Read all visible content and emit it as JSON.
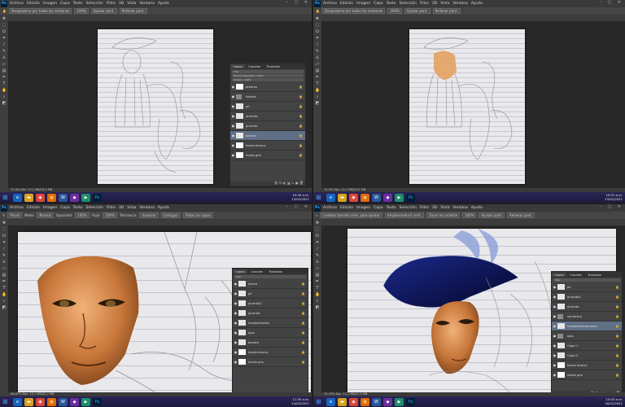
{
  "menu": [
    "Archivo",
    "Edición",
    "Imagen",
    "Capa",
    "Texto",
    "Selección",
    "Filtro",
    "3D",
    "Vista",
    "Ventana",
    "Ayuda"
  ],
  "app_icon": "Ps",
  "window_controls": "– ▢ ✕",
  "q1": {
    "options": [
      "Desplazarse por todas las ventanas",
      "100%",
      "Ajustar pant.",
      "Rellenar pant."
    ],
    "doc_tab": "SCI_Mtz_Digital_PaintIng_Mascara_14-02-2021_2088x3474-300.psd al 12.5% (bosceto, RGB/8) ×",
    "status": "12,5%   Doc: 12,1 MB/15,5 MB",
    "panel_tabs": [
      "Capas",
      "Canales",
      "Trazados"
    ],
    "layers_filter": "Tipo",
    "blend_mode": "Normal",
    "opacity": "Opacidad: 100%",
    "fill": "Relleno: 100%",
    "layers": [
      {
        "name": "piedras",
        "kind": "white",
        "sel": false
      },
      {
        "name": "fondos",
        "kind": "folder",
        "sel": false
      },
      {
        "name": "pil",
        "kind": "pattern",
        "sel": false
      },
      {
        "name": "plumita",
        "kind": "pattern",
        "sel": false
      },
      {
        "name": "plumita",
        "kind": "pattern",
        "sel": false
      },
      {
        "name": "boceto",
        "kind": "pattern",
        "sel": true
      },
      {
        "name": "fondo blanco",
        "kind": "white",
        "sel": false
      },
      {
        "name": "fondo gris",
        "kind": "white",
        "sel": false
      }
    ],
    "time": "10:40 a.m.",
    "date": "13/02/2021"
  },
  "q2": {
    "options": [
      "Desplazarse por todas las ventanas",
      "100%",
      "Ajustar pant.",
      "Rellenar pant."
    ],
    "doc_tab": "SCI_Mtz_Digital_PaintIng_Mascara_14-02-2021_2088x3474-300.psd al 12.5% (boscaro, RGB/8) ×",
    "status": "12,5%   Doc: 12,1 MB/15,5 MB",
    "time": "10:31 a.m.",
    "date": "13/02/2021"
  },
  "q3": {
    "options": [
      "Pincel",
      "Modo:",
      "Normal",
      "Opacidad:",
      "100%",
      "Flujo:",
      "100%",
      "Tolerancia:",
      "Suavizar",
      "Contiguo",
      "Todas las capas"
    ],
    "doc_tab": "SCI_Mtz_Digital_PaintIng_Mascara_14-02-2021_2088x3474-300.psd al 66.7% (sombrasdelrostro, RGB/8) ×",
    "status": "66,67%   Doc: 12,1 MB/20,7 MB",
    "panel_tabs": [
      "Capas",
      "Canales",
      "Trazados"
    ],
    "layers_filter": "Tipo",
    "layers": [
      {
        "name": "forma",
        "kind": "pattern",
        "sel": false
      },
      {
        "name": "pil",
        "kind": "pattern",
        "sel": false
      },
      {
        "name": "plumita2",
        "kind": "pattern",
        "sel": false
      },
      {
        "name": "plumita",
        "kind": "pattern",
        "sel": false
      },
      {
        "name": "fondbrillantes",
        "kind": "pattern",
        "sel": false
      },
      {
        "name": "ojos",
        "kind": "pattern",
        "sel": false
      },
      {
        "name": "boceto",
        "kind": "pattern",
        "sel": false
      },
      {
        "name": "fondo blanco",
        "kind": "white",
        "sel": false
      },
      {
        "name": "fondo gris",
        "kind": "white",
        "sel": false
      }
    ],
    "time": "11:35 a.m.",
    "date": "14/02/2021"
  },
  "q4": {
    "options": [
      "Cambiar tamaño vent. para ajustar",
      "Ampliar/reducir vent.",
      "Zoom en arrastre",
      "100%",
      "Ajustar pant.",
      "Rellenar pant."
    ],
    "doc_tab": "SCI_Mtz_Digital_PaintIng_Mascara_14-02-2021_2088x3474-300.psd al 33.3% (somrbasdelrostro01, RGB/8) ×",
    "status": "33,33%   Doc: 12,1 MB/23,9 MB",
    "panel_tabs": [
      "Capas",
      "Canales",
      "Trazados"
    ],
    "layers_filter": "Tipo",
    "layers": [
      {
        "name": "pil",
        "kind": "pattern",
        "sel": false
      },
      {
        "name": "plumita2",
        "kind": "pattern",
        "sel": false
      },
      {
        "name": "plumita",
        "kind": "pattern",
        "sel": false
      },
      {
        "name": "sombrero",
        "kind": "folder",
        "sel": false
      },
      {
        "name": "fondbrillantesrostro",
        "kind": "pattern",
        "sel": true
      },
      {
        "name": "ojos",
        "kind": "folder",
        "sel": false
      },
      {
        "name": "Capa 1",
        "kind": "pattern",
        "sel": false
      },
      {
        "name": "Capa 2",
        "kind": "pattern",
        "sel": false
      },
      {
        "name": "fondo blanco",
        "kind": "white",
        "sel": false
      },
      {
        "name": "fondo gris",
        "kind": "white",
        "sel": false
      }
    ],
    "time": "10:03 a.m.",
    "date": "16/02/2021"
  },
  "colors": {
    "ps_blue": "#31a8ff",
    "skin": "#c9793a",
    "hat": "#1a2a7a",
    "plume": "#8fa3d9"
  }
}
